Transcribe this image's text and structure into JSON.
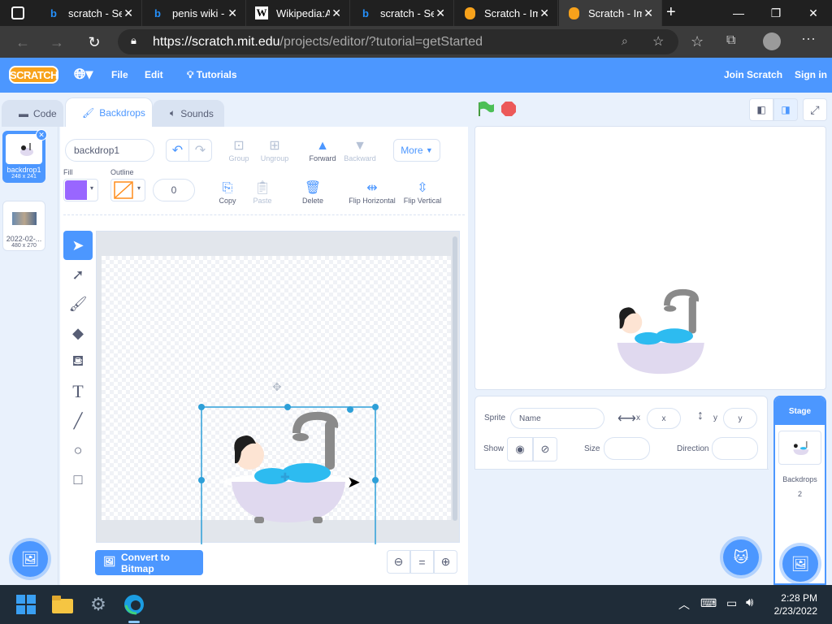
{
  "browser": {
    "tabs": [
      {
        "title": "scratch - Se",
        "icon": "bing-icon",
        "color": "#258ffa"
      },
      {
        "title": "penis wiki -",
        "icon": "bing-icon",
        "color": "#258ffa"
      },
      {
        "title": "Wikipedia:A",
        "icon": "wikipedia-icon",
        "color": "#ffffff"
      },
      {
        "title": "scratch - Se",
        "icon": "bing-icon",
        "color": "#258ffa"
      },
      {
        "title": "Scratch - Im",
        "icon": "scratch-icon",
        "color": "#f7a21b"
      },
      {
        "title": "Scratch - Im",
        "icon": "scratch-icon",
        "color": "#f7a21b"
      }
    ],
    "url_main": "https://scratch.mit.edu",
    "url_rest": "/projects/editor/?tutorial=getStarted"
  },
  "menubar": {
    "logo": "SCRATCH",
    "file": "File",
    "edit": "Edit",
    "tutorials": "Tutorials",
    "join": "Join Scratch",
    "signin": "Sign in"
  },
  "editor_tabs": {
    "code": "Code",
    "backdrops": "Backdrops",
    "sounds": "Sounds"
  },
  "backdrops": [
    {
      "num": "1",
      "name": "backdrop1",
      "size": "248 x 241"
    },
    {
      "num": "2",
      "name": "2022-02-...",
      "size": "480 x 270"
    }
  ],
  "paint": {
    "name_value": "backdrop1",
    "fill_label": "Fill",
    "outline_label": "Outline",
    "outline_width": "0",
    "group": "Group",
    "ungroup": "Ungroup",
    "forward": "Forward",
    "backward": "Backward",
    "more": "More",
    "copy": "Copy",
    "paste": "Paste",
    "delete": "Delete",
    "flip_h": "Flip Horizontal",
    "flip_v": "Flip Vertical",
    "convert": "Convert to Bitmap",
    "fill_color": "#9966ff"
  },
  "sprite_info": {
    "sprite_label": "Sprite",
    "name_placeholder": "Name",
    "x_label": "x",
    "x_placeholder": "x",
    "y_label": "y",
    "y_placeholder": "y",
    "show_label": "Show",
    "size_label": "Size",
    "direction_label": "Direction"
  },
  "stage_pane": {
    "title": "Stage",
    "backdrops_label": "Backdrops",
    "backdrops_count": "2"
  },
  "taskbar": {
    "time": "2:28 PM",
    "date": "2/23/2022"
  }
}
